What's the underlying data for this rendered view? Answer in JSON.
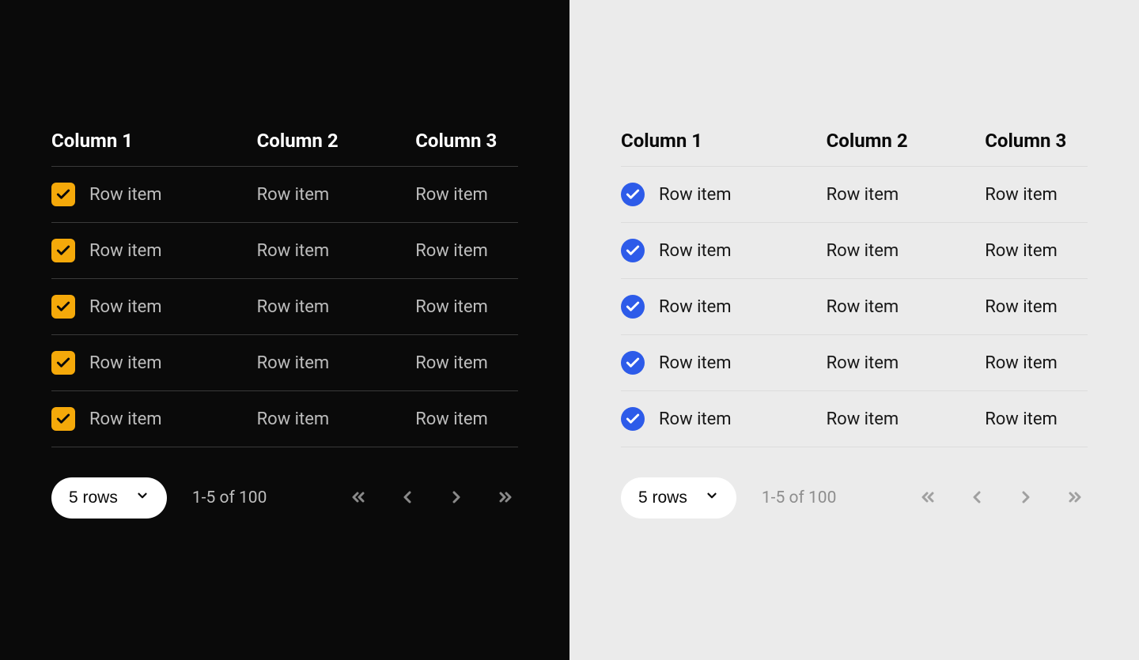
{
  "columns": [
    "Column 1",
    "Column 2",
    "Column 3"
  ],
  "cell_text": "Row item",
  "rows_per_page_label": "5 rows",
  "page_status": "1-5 of 100",
  "colors": {
    "dark_bg": "#0a0a0a",
    "light_bg": "#ebebeb",
    "checkbox_dark": "#f5a90a",
    "checkbox_light": "#2d5be9"
  },
  "row_count": 5
}
